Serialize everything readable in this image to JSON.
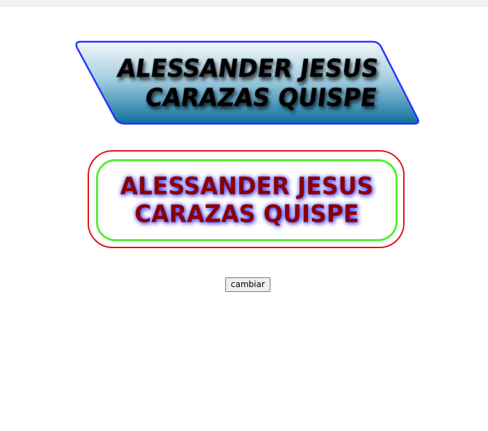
{
  "banner_skewed": {
    "line1": "ALESSANDER JESUS",
    "line2": "CARAZAS QUISPE",
    "gradient_top": "#f2f6f9",
    "gradient_bottom": "#0b6f9c",
    "border_color": "#2233ff"
  },
  "banner_rounded": {
    "line1": "ALESSANDER JESUS",
    "line2": "CARAZAS QUISPE",
    "text_color": "#8b0000",
    "outer_border_color": "#e01010",
    "inner_border_color": "#55ee33",
    "glow_color": "#5555ff"
  },
  "actions": {
    "change_label": "cambiar"
  }
}
